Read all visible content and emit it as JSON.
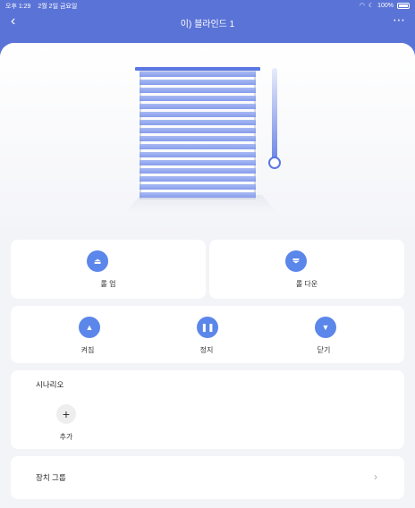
{
  "status": {
    "time": "오후 1:29",
    "date": "2월 2일 금요일",
    "battery": "100%"
  },
  "header": {
    "title": "이) 블라인드 1"
  },
  "controls": {
    "roll_up": "롤 업",
    "roll_down": "롤 다운",
    "open": "켜짐",
    "stop": "정지",
    "close": "닫기"
  },
  "scenario": {
    "title": "시나리오",
    "add_label": "추가"
  },
  "device_group": {
    "label": "장치 그룹"
  },
  "blind": {
    "level_fraction": 1.0
  },
  "colors": {
    "accent": "#5b86ea",
    "header": "#5a73d6"
  }
}
